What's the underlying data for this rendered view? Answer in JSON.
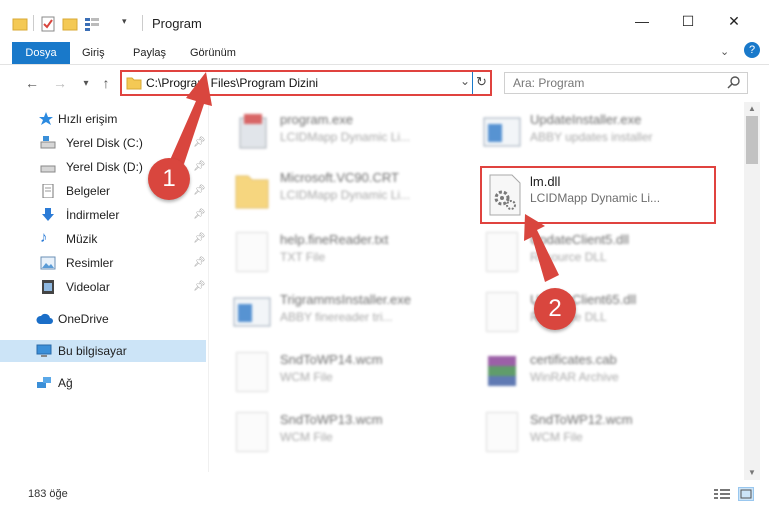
{
  "window": {
    "title": "Program"
  },
  "ribbon": {
    "tabs": [
      "Dosya",
      "Giriş",
      "Paylaş",
      "Görünüm"
    ]
  },
  "address": {
    "path": "C:\\Program Files\\Program Dizini"
  },
  "search": {
    "placeholder": "Ara: Program"
  },
  "nav": {
    "items": [
      {
        "label": "Hızlı erişim"
      },
      {
        "label": "Yerel Disk (C:)"
      },
      {
        "label": "Yerel Disk (D:)"
      },
      {
        "label": "Belgeler"
      },
      {
        "label": "İndirmeler"
      },
      {
        "label": "Müzik"
      },
      {
        "label": "Resimler"
      },
      {
        "label": "Videolar"
      },
      {
        "label": "OneDrive"
      },
      {
        "label": "Bu bilgisayar"
      },
      {
        "label": "Ağ"
      }
    ]
  },
  "files": [
    {
      "name": "program.exe",
      "type": "LCIDMapp Dynamic Li..."
    },
    {
      "name": "UpdateInstaller.exe",
      "type": "ABBY updates installer"
    },
    {
      "name": "Microsoft.VC90.CRT",
      "type": "LCIDMapp Dynamic Li..."
    },
    {
      "name": "lm.dll",
      "type": "LCIDMapp Dynamic Li..."
    },
    {
      "name": "help.fineReader.txt",
      "type": "TXT File"
    },
    {
      "name": "UpdateClient5.dll",
      "type": "Resource DLL"
    },
    {
      "name": "TrigrammsInstaller.exe",
      "type": "ABBY finereader tri..."
    },
    {
      "name": "UpdateClient65.dll",
      "type": "Resource DLL"
    },
    {
      "name": "SndToWP14.wcm",
      "type": "WCM File"
    },
    {
      "name": "certificates.cab",
      "type": "WinRAR Archive"
    },
    {
      "name": "SndToWP13.wcm",
      "type": "WCM File"
    },
    {
      "name": "SndToWP12.wcm",
      "type": "WCM File"
    }
  ],
  "status": {
    "count": "183 öğe"
  },
  "callouts": [
    "1",
    "2"
  ],
  "colors": {
    "accent": "#1979ca",
    "highlight": "#e0433f",
    "selected_nav": "#cce4f7"
  }
}
